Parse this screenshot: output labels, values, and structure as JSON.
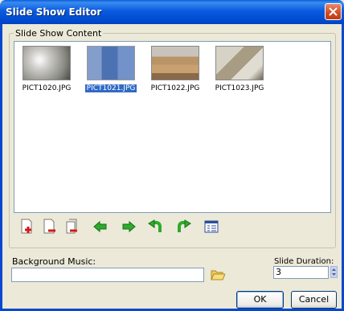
{
  "window": {
    "title": "Slide Show Editor"
  },
  "content": {
    "group_label": "Slide Show Content",
    "thumbnails": [
      {
        "caption": "PICT1020.JPG",
        "selected": false
      },
      {
        "caption": "PICT1021.JPG",
        "selected": true
      },
      {
        "caption": "PICT1022.JPG",
        "selected": false
      },
      {
        "caption": "PICT1023.JPG",
        "selected": false
      }
    ]
  },
  "toolbar": {
    "icons": [
      "add-slide-icon",
      "remove-slide-icon",
      "remove-all-icon",
      "move-left-icon",
      "move-right-icon",
      "rotate-left-icon",
      "rotate-right-icon",
      "properties-icon"
    ]
  },
  "music": {
    "label": "Background Music:",
    "value": ""
  },
  "duration": {
    "label": "Slide Duration:",
    "value": "3"
  },
  "buttons": {
    "ok": "OK",
    "cancel": "Cancel"
  },
  "colors": {
    "title_bar": "#0054e3",
    "selection": "#316ac5",
    "arrow_green": "#1e9a1e"
  }
}
